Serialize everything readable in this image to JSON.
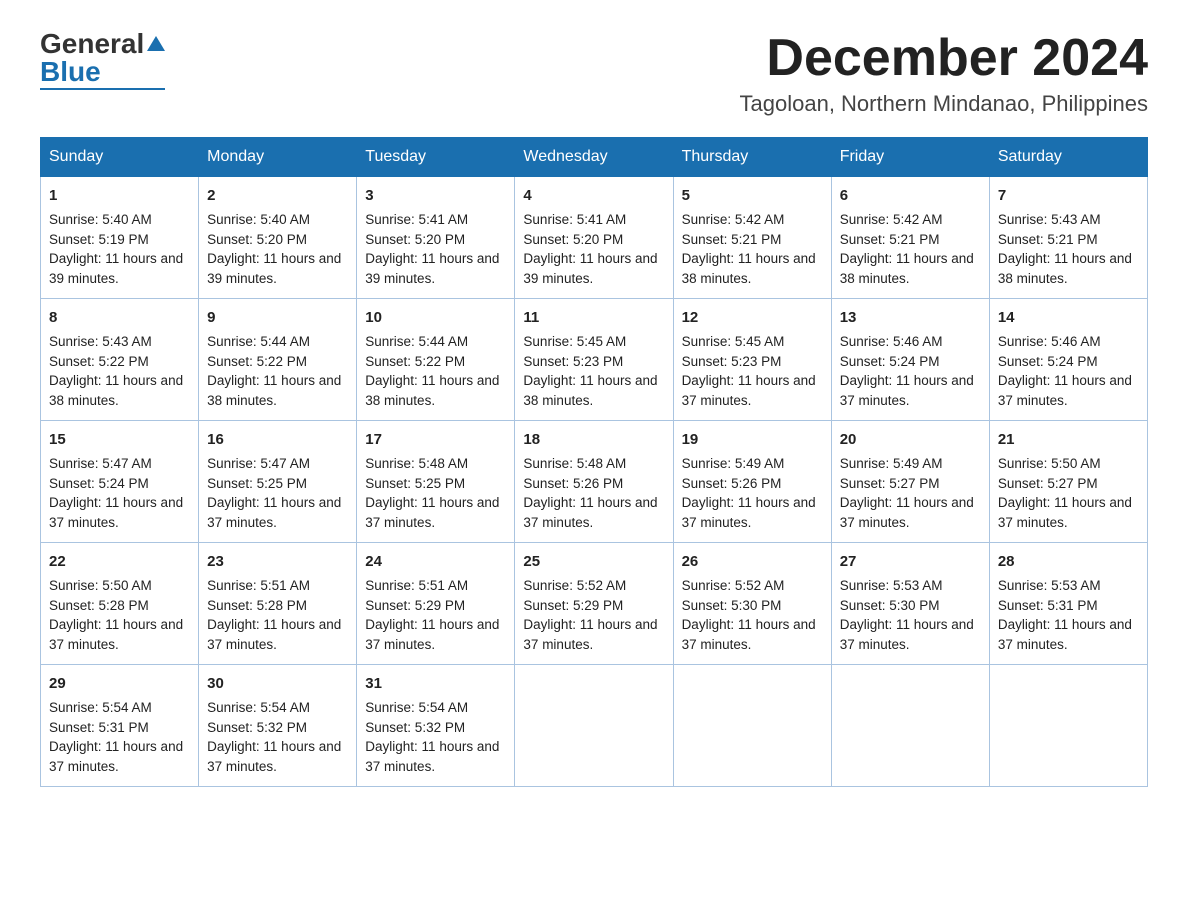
{
  "logo": {
    "general": "General",
    "blue": "Blue"
  },
  "title": "December 2024",
  "subtitle": "Tagoloan, Northern Mindanao, Philippines",
  "days": [
    "Sunday",
    "Monday",
    "Tuesday",
    "Wednesday",
    "Thursday",
    "Friday",
    "Saturday"
  ],
  "weeks": [
    [
      {
        "day": "1",
        "sunrise": "5:40 AM",
        "sunset": "5:19 PM",
        "daylight": "11 hours and 39 minutes."
      },
      {
        "day": "2",
        "sunrise": "5:40 AM",
        "sunset": "5:20 PM",
        "daylight": "11 hours and 39 minutes."
      },
      {
        "day": "3",
        "sunrise": "5:41 AM",
        "sunset": "5:20 PM",
        "daylight": "11 hours and 39 minutes."
      },
      {
        "day": "4",
        "sunrise": "5:41 AM",
        "sunset": "5:20 PM",
        "daylight": "11 hours and 39 minutes."
      },
      {
        "day": "5",
        "sunrise": "5:42 AM",
        "sunset": "5:21 PM",
        "daylight": "11 hours and 38 minutes."
      },
      {
        "day": "6",
        "sunrise": "5:42 AM",
        "sunset": "5:21 PM",
        "daylight": "11 hours and 38 minutes."
      },
      {
        "day": "7",
        "sunrise": "5:43 AM",
        "sunset": "5:21 PM",
        "daylight": "11 hours and 38 minutes."
      }
    ],
    [
      {
        "day": "8",
        "sunrise": "5:43 AM",
        "sunset": "5:22 PM",
        "daylight": "11 hours and 38 minutes."
      },
      {
        "day": "9",
        "sunrise": "5:44 AM",
        "sunset": "5:22 PM",
        "daylight": "11 hours and 38 minutes."
      },
      {
        "day": "10",
        "sunrise": "5:44 AM",
        "sunset": "5:22 PM",
        "daylight": "11 hours and 38 minutes."
      },
      {
        "day": "11",
        "sunrise": "5:45 AM",
        "sunset": "5:23 PM",
        "daylight": "11 hours and 38 minutes."
      },
      {
        "day": "12",
        "sunrise": "5:45 AM",
        "sunset": "5:23 PM",
        "daylight": "11 hours and 37 minutes."
      },
      {
        "day": "13",
        "sunrise": "5:46 AM",
        "sunset": "5:24 PM",
        "daylight": "11 hours and 37 minutes."
      },
      {
        "day": "14",
        "sunrise": "5:46 AM",
        "sunset": "5:24 PM",
        "daylight": "11 hours and 37 minutes."
      }
    ],
    [
      {
        "day": "15",
        "sunrise": "5:47 AM",
        "sunset": "5:24 PM",
        "daylight": "11 hours and 37 minutes."
      },
      {
        "day": "16",
        "sunrise": "5:47 AM",
        "sunset": "5:25 PM",
        "daylight": "11 hours and 37 minutes."
      },
      {
        "day": "17",
        "sunrise": "5:48 AM",
        "sunset": "5:25 PM",
        "daylight": "11 hours and 37 minutes."
      },
      {
        "day": "18",
        "sunrise": "5:48 AM",
        "sunset": "5:26 PM",
        "daylight": "11 hours and 37 minutes."
      },
      {
        "day": "19",
        "sunrise": "5:49 AM",
        "sunset": "5:26 PM",
        "daylight": "11 hours and 37 minutes."
      },
      {
        "day": "20",
        "sunrise": "5:49 AM",
        "sunset": "5:27 PM",
        "daylight": "11 hours and 37 minutes."
      },
      {
        "day": "21",
        "sunrise": "5:50 AM",
        "sunset": "5:27 PM",
        "daylight": "11 hours and 37 minutes."
      }
    ],
    [
      {
        "day": "22",
        "sunrise": "5:50 AM",
        "sunset": "5:28 PM",
        "daylight": "11 hours and 37 minutes."
      },
      {
        "day": "23",
        "sunrise": "5:51 AM",
        "sunset": "5:28 PM",
        "daylight": "11 hours and 37 minutes."
      },
      {
        "day": "24",
        "sunrise": "5:51 AM",
        "sunset": "5:29 PM",
        "daylight": "11 hours and 37 minutes."
      },
      {
        "day": "25",
        "sunrise": "5:52 AM",
        "sunset": "5:29 PM",
        "daylight": "11 hours and 37 minutes."
      },
      {
        "day": "26",
        "sunrise": "5:52 AM",
        "sunset": "5:30 PM",
        "daylight": "11 hours and 37 minutes."
      },
      {
        "day": "27",
        "sunrise": "5:53 AM",
        "sunset": "5:30 PM",
        "daylight": "11 hours and 37 minutes."
      },
      {
        "day": "28",
        "sunrise": "5:53 AM",
        "sunset": "5:31 PM",
        "daylight": "11 hours and 37 minutes."
      }
    ],
    [
      {
        "day": "29",
        "sunrise": "5:54 AM",
        "sunset": "5:31 PM",
        "daylight": "11 hours and 37 minutes."
      },
      {
        "day": "30",
        "sunrise": "5:54 AM",
        "sunset": "5:32 PM",
        "daylight": "11 hours and 37 minutes."
      },
      {
        "day": "31",
        "sunrise": "5:54 AM",
        "sunset": "5:32 PM",
        "daylight": "11 hours and 37 minutes."
      },
      null,
      null,
      null,
      null
    ]
  ],
  "labels": {
    "sunrise": "Sunrise: ",
    "sunset": "Sunset: ",
    "daylight": "Daylight: "
  }
}
